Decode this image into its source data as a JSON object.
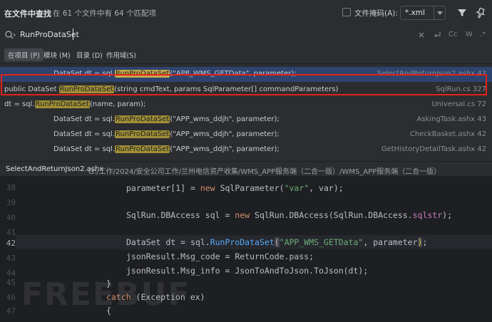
{
  "header": {
    "title": "在文件中查找",
    "summary": "在 61 个文件中有 64 个匹配项",
    "file_mask_label": "文件掩码(A):",
    "file_mask_value": "*.xml"
  },
  "search": {
    "query": "RunProDataSet",
    "match_case_label": "Cc",
    "words_label": "W",
    "regex_label": ".*"
  },
  "scopes": [
    {
      "label": "在项目 (P)",
      "active": true
    },
    {
      "label": "模块 (M)",
      "active": false
    },
    {
      "label": "目录 (D)",
      "active": false
    },
    {
      "label": "作用域(S)",
      "active": false
    }
  ],
  "results": [
    {
      "pre": "DataSet dt = sql.",
      "match": "RunProDataSet",
      "post": "(\"APP_WMS_GETData\", parameter);",
      "file": "SelectAndReturnJson2.ashx 42"
    },
    {
      "pre": "public DataSet ",
      "match": "RunProDataSet",
      "post": "(string cmdText, params SqlParameter[] commandParameters)",
      "file": "SqlRun.cs 327"
    },
    {
      "pre": "dt = sql.",
      "match": "RunProDataSet",
      "post": "(name, param);",
      "file": "Universal.cs 72"
    },
    {
      "pre": "DataSet dt = sql.",
      "match": "RunProDataSet",
      "post": "(\"APP_wms_ddjh\", parameter);",
      "file": "AskingTask.ashx 43"
    },
    {
      "pre": "DataSet dt = sql.",
      "match": "RunProDataSet",
      "post": "(\"APP_wms_ddjh\", parameter);",
      "file": "CheckBasket.ashx 42"
    },
    {
      "pre": "DataSet dt = sql.",
      "match": "RunProDataSet",
      "post": "(\"APP_wms_ddjh\", parameter);",
      "file": "GetHistoryDetailTask.ashx 42"
    }
  ],
  "path_bar": {
    "file": "SelectAndReturnJson2.ashx",
    "dir": "G:/工作/2024/安全公司工作/兰州电信资产收集/WMS_APP服务端（二合一版）/WMS_APP服务端（二合一版）"
  },
  "editor": {
    "current_line": 42,
    "line_numbers": [
      "38",
      "39",
      "40",
      "41",
      "42",
      "43",
      "44",
      "45",
      "46",
      "47"
    ],
    "lines": {
      "l38_a": "parameter[1] = ",
      "l38_b": "new",
      "l38_c": " SqlParameter(",
      "l38_d": "\"var\"",
      "l38_e": ", var);",
      "l40_a": "SqlRun.DBAccess sql = ",
      "l40_b": "new",
      "l40_c": " SqlRun.DBAccess(SqlRun.DBAccess.",
      "l40_d": "sqlstr",
      "l40_e": ");",
      "l42_a": "DataSet dt = sql.",
      "l42_b": "RunProDataSet",
      "l42_c": "(",
      "l42_d": "\"APP_WMS_GETData\"",
      "l42_e": ", parameter",
      "l42_f": ")",
      "l42_g": ";",
      "l43": "jsonResult.Msg_code = ReturnCode.pass;",
      "l44": "jsonResult.Msg_info = JsonToAndToJson.ToJson(dt);",
      "l45": "}",
      "l46_a": "catch",
      "l46_b": " (Exception ex)",
      "l47": "{"
    }
  },
  "watermark": "FREEBUF"
}
